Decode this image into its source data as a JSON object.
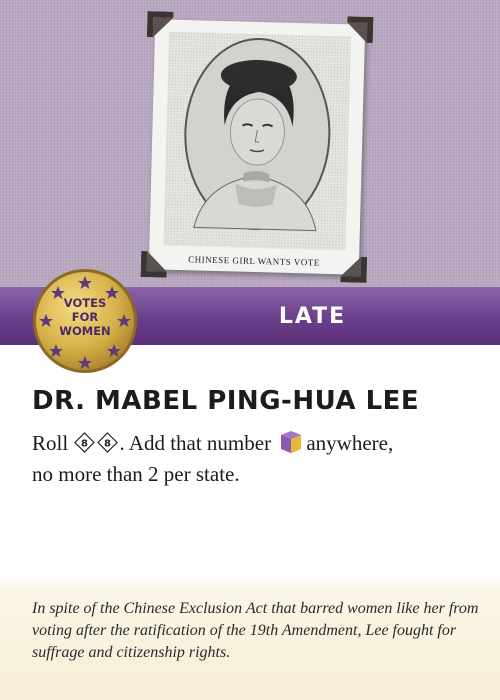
{
  "photo": {
    "caption": "CHINESE GIRL WANTS VOTE"
  },
  "badge": {
    "line1": "VOTES",
    "line2": "FOR",
    "line3": "WOMEN"
  },
  "band": {
    "label": "LATE"
  },
  "card": {
    "title": "DR. MABEL PING-HUA LEE"
  },
  "rules": {
    "roll": "Roll",
    "die1": "8",
    "die2": "8",
    "mid": ". Add that number",
    "end": "anywhere,",
    "line2": "no more than 2 per state."
  },
  "flavor": {
    "text": "In spite of the Chinese Exclusion Act that barred women like her from voting after the ratification of the 19th Amendment, Lee fought for suffrage and citizenship rights."
  },
  "colors": {
    "linen": "#b9a9c0",
    "band": "#6a3f8a",
    "badge_gold": "#d8b24a",
    "cube_purple": "#8a5bb0",
    "cube_yellow": "#e8b838",
    "flavor_bg": "#f6edd6"
  },
  "icons": [
    "photo-corner-icon",
    "votes-for-women-badge-icon",
    "d8-die-icon",
    "cube-token-icon"
  ]
}
